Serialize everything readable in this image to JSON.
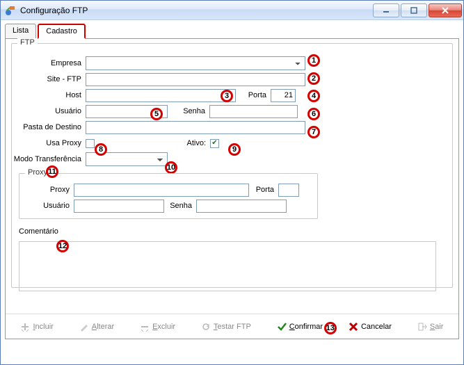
{
  "window": {
    "title": "Configuração FTP"
  },
  "tabs": {
    "lista": "Lista",
    "cadastro": "Cadastro"
  },
  "group": {
    "legend": "FTP"
  },
  "form": {
    "empresa_label": "Empresa",
    "site_label": "Site - FTP",
    "host_label": "Host",
    "porta_label": "Porta",
    "porta_value": "21",
    "usuario_label": "Usuário",
    "senha_label": "Senha",
    "pasta_label": "Pasta de Destino",
    "usaproxy_label": "Usa Proxy",
    "ativo_label": "Ativo:",
    "modo_label": "Modo Transferência"
  },
  "proxy": {
    "legend": "Proxy",
    "proxy_label": "Proxy",
    "porta_label": "Porta",
    "usuario_label": "Usuário",
    "senha_label": "Senha"
  },
  "comment_label": "Comentário",
  "annotations": {
    "a1": "1",
    "a2": "2",
    "a3": "3",
    "a4": "4",
    "a5": "5",
    "a6": "6",
    "a7": "7",
    "a8": "8",
    "a9": "9",
    "a10": "10",
    "a11": "11",
    "a12": "12",
    "a13": "13"
  },
  "toolbar": {
    "incluir": "Incluir",
    "alterar": "Alterar",
    "excluir": "Excluir",
    "testar": "Testar FTP",
    "confirmar": "Confirmar",
    "cancelar": "Cancelar",
    "sair": "Sair"
  }
}
